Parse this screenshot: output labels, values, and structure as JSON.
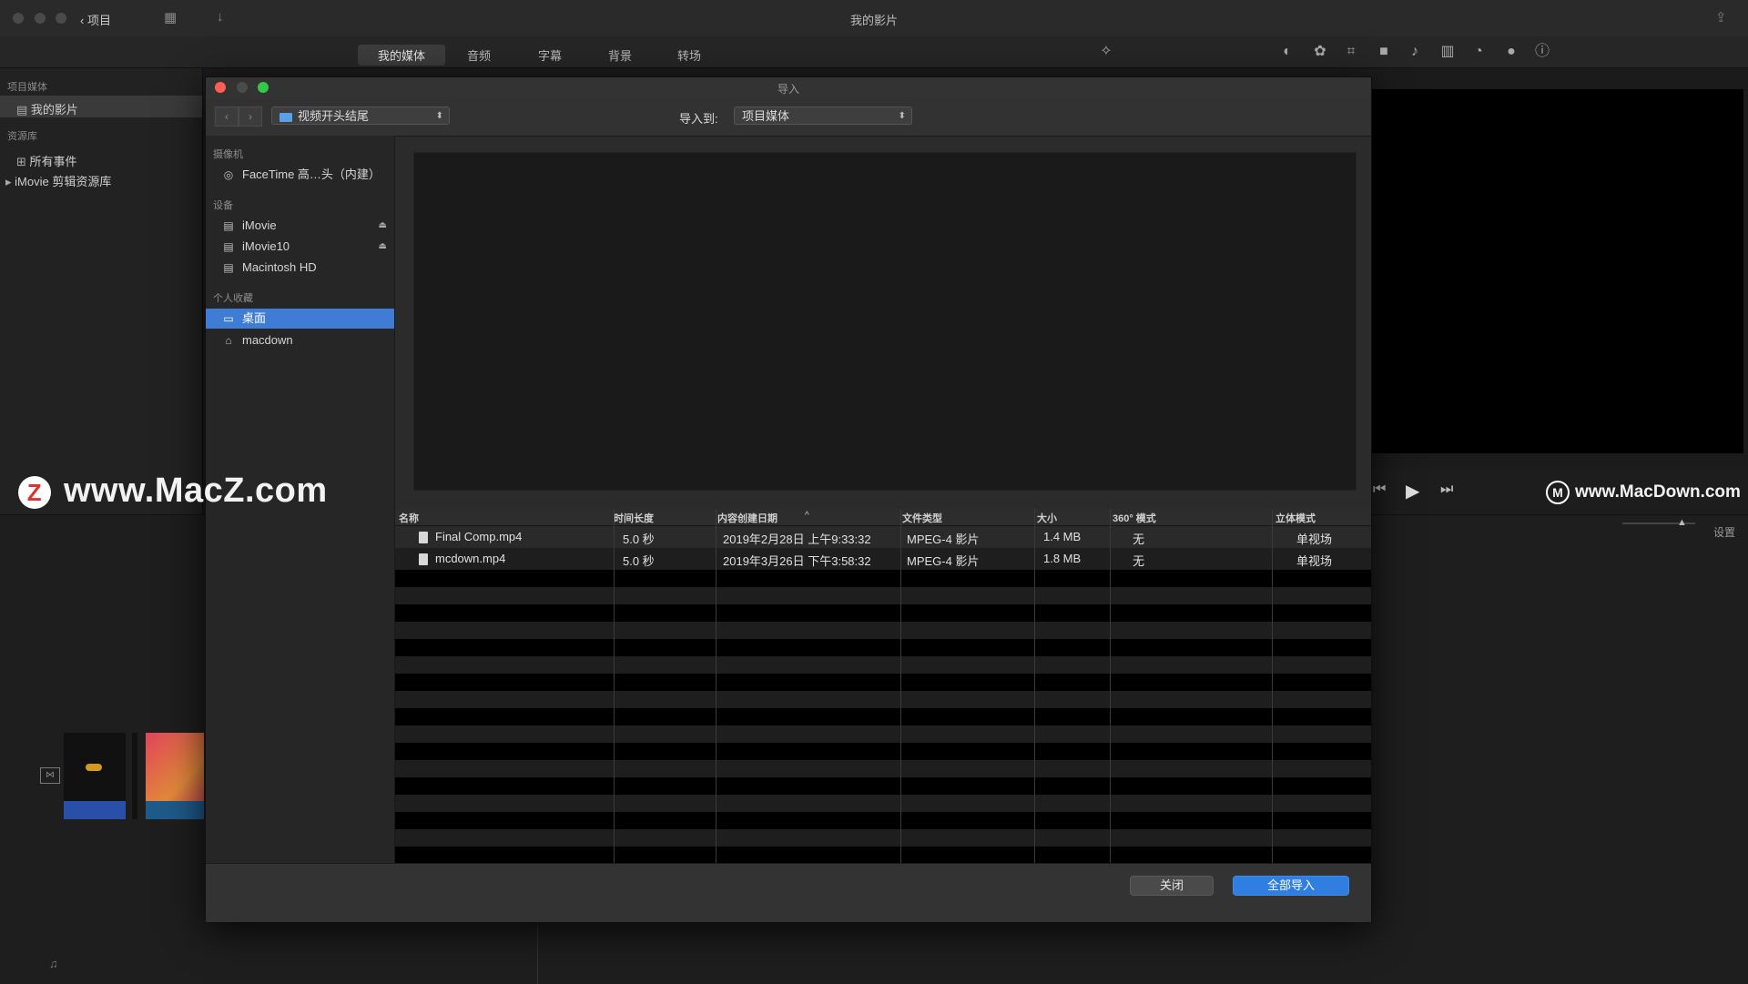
{
  "app": {
    "window_title": "我的影片",
    "back_label": "项目",
    "tabs": [
      "我的媒体",
      "音频",
      "字幕",
      "背景",
      "转场"
    ],
    "active_tab": "我的媒体",
    "settings_label": "设置"
  },
  "library": {
    "section_project_media": "项目媒体",
    "project_item": "我的影片",
    "section_libraries": "资源库",
    "all_events": "所有事件",
    "imovie_library": "iMovie 剪辑资源库"
  },
  "dialog": {
    "title": "导入",
    "source_popup": "视频开头结尾",
    "import_to_label": "导入到:",
    "import_to_value": "项目媒体",
    "sidebar": {
      "cameras_head": "摄像机",
      "cameras": [
        {
          "label": "FaceTime 高…头（内建）",
          "icon": "camera-icon"
        }
      ],
      "devices_head": "设备",
      "devices": [
        {
          "label": "iMovie",
          "icon": "disk-icon",
          "eject": true
        },
        {
          "label": "iMovie10",
          "icon": "disk-icon",
          "eject": true
        },
        {
          "label": "Macintosh HD",
          "icon": "disk-icon",
          "eject": false
        }
      ],
      "favorites_head": "个人收藏",
      "favorites": [
        {
          "label": "桌面",
          "icon": "desktop-icon",
          "selected": true
        },
        {
          "label": "macdown",
          "icon": "home-icon",
          "selected": false
        }
      ]
    },
    "table": {
      "columns": [
        "名称",
        "时间长度",
        "内容创建日期",
        "文件类型",
        "大小",
        "360° 模式",
        "立体模式"
      ],
      "rows": [
        [
          "Final Comp.mp4",
          "5.0 秒",
          "2019年2月28日 上午9:33:32",
          "MPEG-4 影片",
          "1.4 MB",
          "无",
          "单视场"
        ],
        [
          "mcdown.mp4",
          "5.0 秒",
          "2019年3月26日 下午3:58:32",
          "MPEG-4 影片",
          "1.8 MB",
          "无",
          "单视场"
        ]
      ]
    },
    "buttons": {
      "close": "关闭",
      "import_all": "全部导入"
    }
  },
  "watermarks": {
    "left": "www.MacZ.com",
    "right": "www.MacDown.com"
  },
  "colors": {
    "accent": "#2f7ee0",
    "selection": "#3e7cd6"
  }
}
